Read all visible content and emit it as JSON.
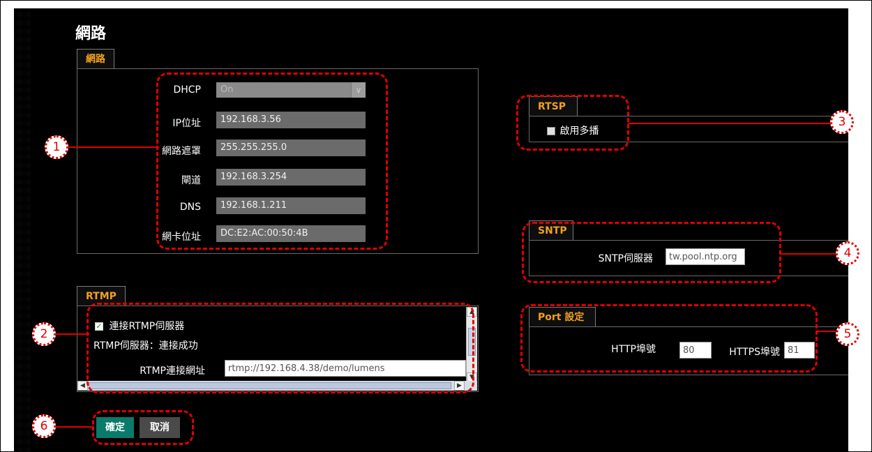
{
  "page": {
    "title": "網路"
  },
  "network": {
    "tab": "網路",
    "dhcp": {
      "label": "DHCP",
      "value": "On",
      "arrow": "∨"
    },
    "ip": {
      "label": "IP位址",
      "value": "192.168.3.56"
    },
    "mask": {
      "label": "網路遮罩",
      "value": "255.255.255.0"
    },
    "gateway": {
      "label": "閘道",
      "value": "192.168.3.254"
    },
    "dns": {
      "label": "DNS",
      "value": "192.168.1.211"
    },
    "mac": {
      "label": "網卡位址",
      "value": "DC:E2:AC:00:50:4B"
    }
  },
  "rtmp": {
    "tab": "RTMP",
    "enable_label": "連接RTMP伺服器",
    "enabled": true,
    "status": "RTMP伺服器：連接成功",
    "url_label": "RTMP連接網址",
    "url_value": "rtmp://192.168.4.38/demo/lumens"
  },
  "rtsp": {
    "tab": "RTSP",
    "multicast_label": "啟用多播",
    "multicast": false
  },
  "sntp": {
    "tab": "SNTP",
    "server_label": "SNTP伺服器",
    "server_value": "tw.pool.ntp.org"
  },
  "port": {
    "tab": "Port 設定",
    "http_label": "HTTP埠號",
    "http_value": "80",
    "https_label": "HTTPS埠號",
    "https_value": "81"
  },
  "buttons": {
    "ok": "確定",
    "cancel": "取消"
  },
  "callouts": [
    "1",
    "2",
    "3",
    "4",
    "5",
    "6"
  ],
  "colors": {
    "accent": "#f0a020",
    "callout": "#e00000",
    "ok_button": "#0a7a6a",
    "field": "#6b6b6b"
  }
}
